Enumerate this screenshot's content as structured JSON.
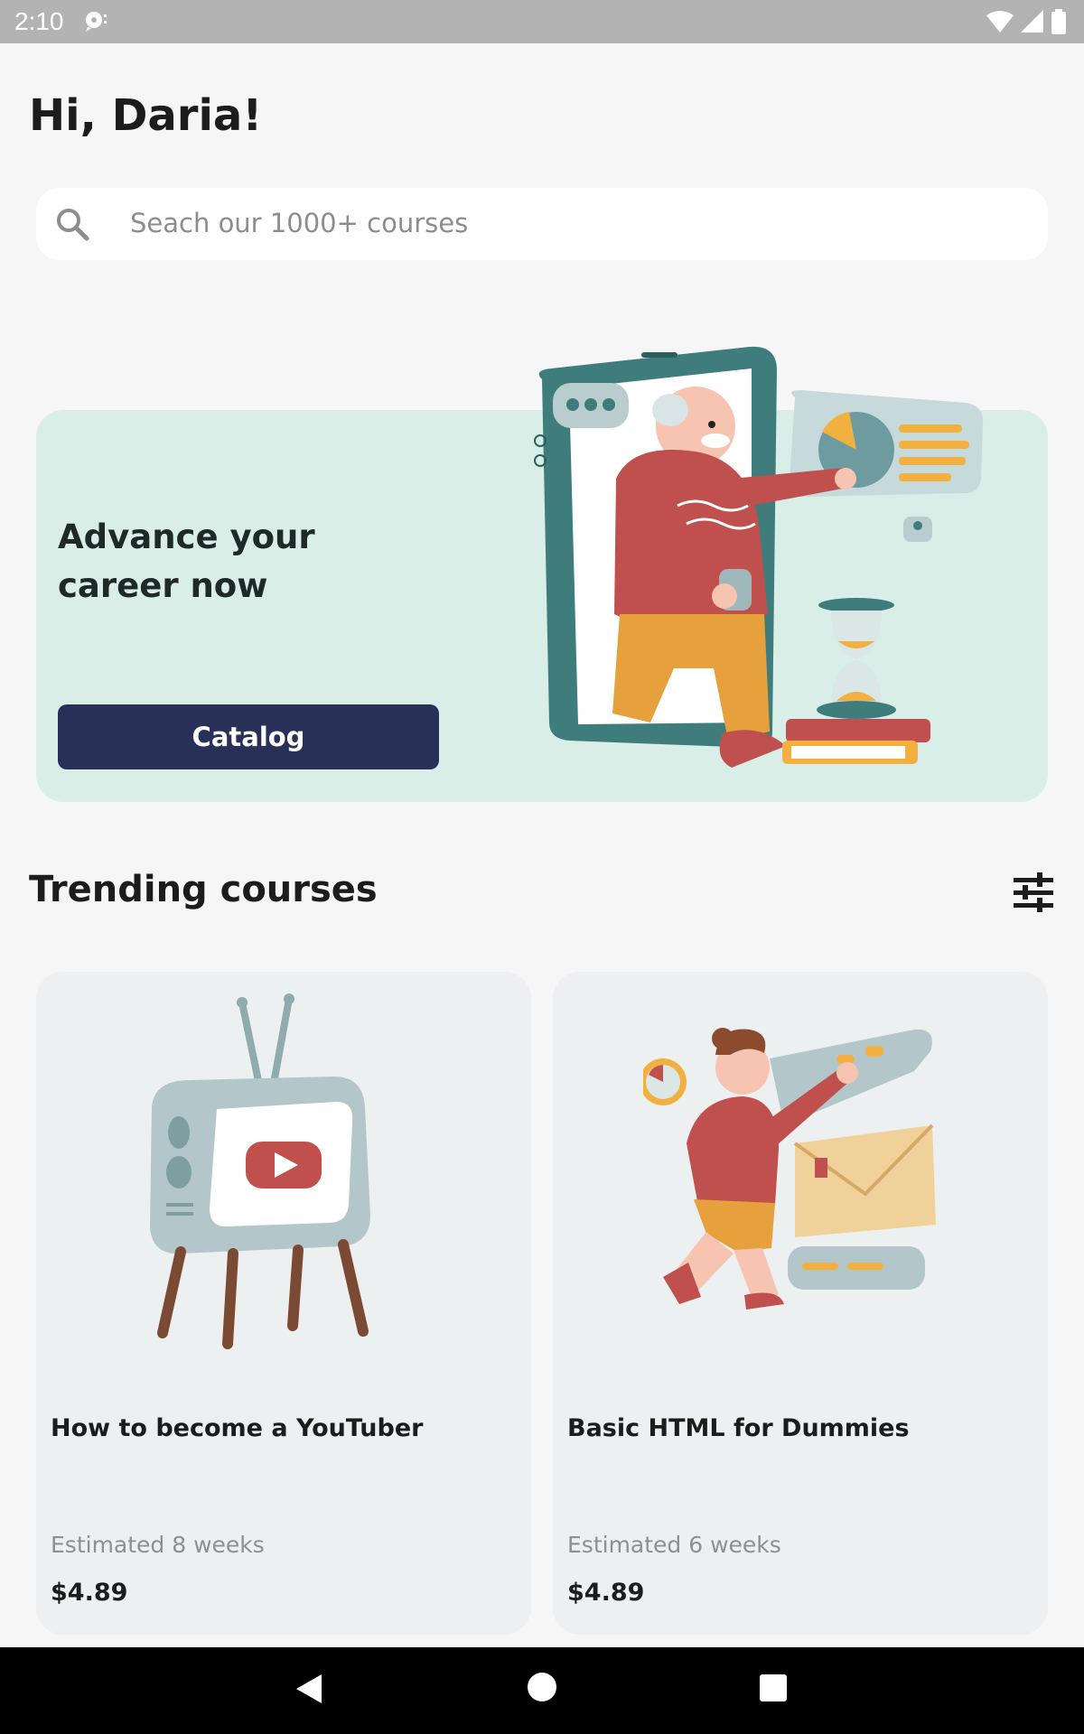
{
  "status_bar": {
    "time": "2:10",
    "icons": [
      "notification-icon",
      "wifi-icon",
      "signal-icon",
      "battery-icon"
    ]
  },
  "greeting": "Hi, Daria!",
  "search": {
    "placeholder": "Seach our 1000+ courses",
    "icon": "search-icon"
  },
  "banner": {
    "title": "Advance your career now",
    "button_label": "Catalog",
    "colors": {
      "background": "#d9eee6",
      "button": "#283058"
    }
  },
  "trending": {
    "title": "Trending courses",
    "filter_icon": "tune-icon",
    "courses": [
      {
        "title": "How to become a YouTuber",
        "duration": "Estimated 8 weeks",
        "price": "$4.89",
        "illustration": "retro-tv-icon"
      },
      {
        "title": "Basic HTML for Dummies",
        "duration": "Estimated 6 weeks",
        "price": "$4.89",
        "illustration": "person-with-envelope-icon"
      }
    ]
  },
  "nav_bar": {
    "icons": [
      "back-icon",
      "home-icon",
      "recents-icon"
    ]
  }
}
